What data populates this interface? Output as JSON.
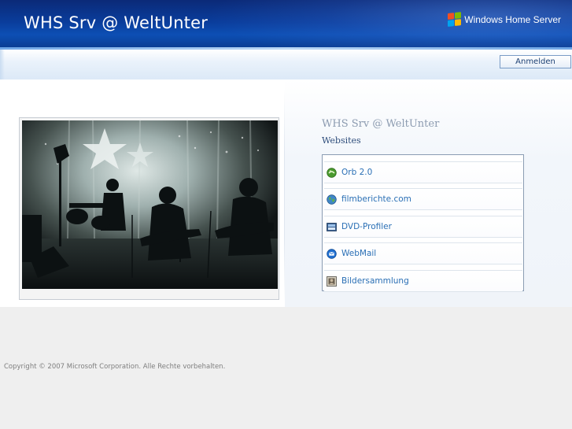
{
  "header": {
    "site_title": "WHS Srv @ WeltUnter",
    "brand_text": "Windows Home Server",
    "logo_colors": [
      "#f25022",
      "#7fba00",
      "#00a4ef",
      "#ffb900"
    ]
  },
  "toolbar": {
    "login_label": "Anmelden"
  },
  "main": {
    "server_title": "WHS Srv @ WeltUnter",
    "websites_label": "Websites",
    "sites": [
      {
        "label": "Orb 2.0",
        "icon": "orb-icon"
      },
      {
        "label": "filmberichte.com",
        "icon": "globe-icon"
      },
      {
        "label": "DVD-Profiler",
        "icon": "dvd-profiler-icon"
      },
      {
        "label": "WebMail",
        "icon": "webmail-icon"
      },
      {
        "label": "Bildersammlung",
        "icon": "picture-icon"
      }
    ]
  },
  "footer": {
    "copyright": "Copyright © 2007 Microsoft Corporation. Alle Rechte vorbehalten."
  },
  "colors": {
    "header_blue": "#0a3d9c",
    "link_blue": "#2a6fb5",
    "title_gray": "#8c9bb0"
  }
}
